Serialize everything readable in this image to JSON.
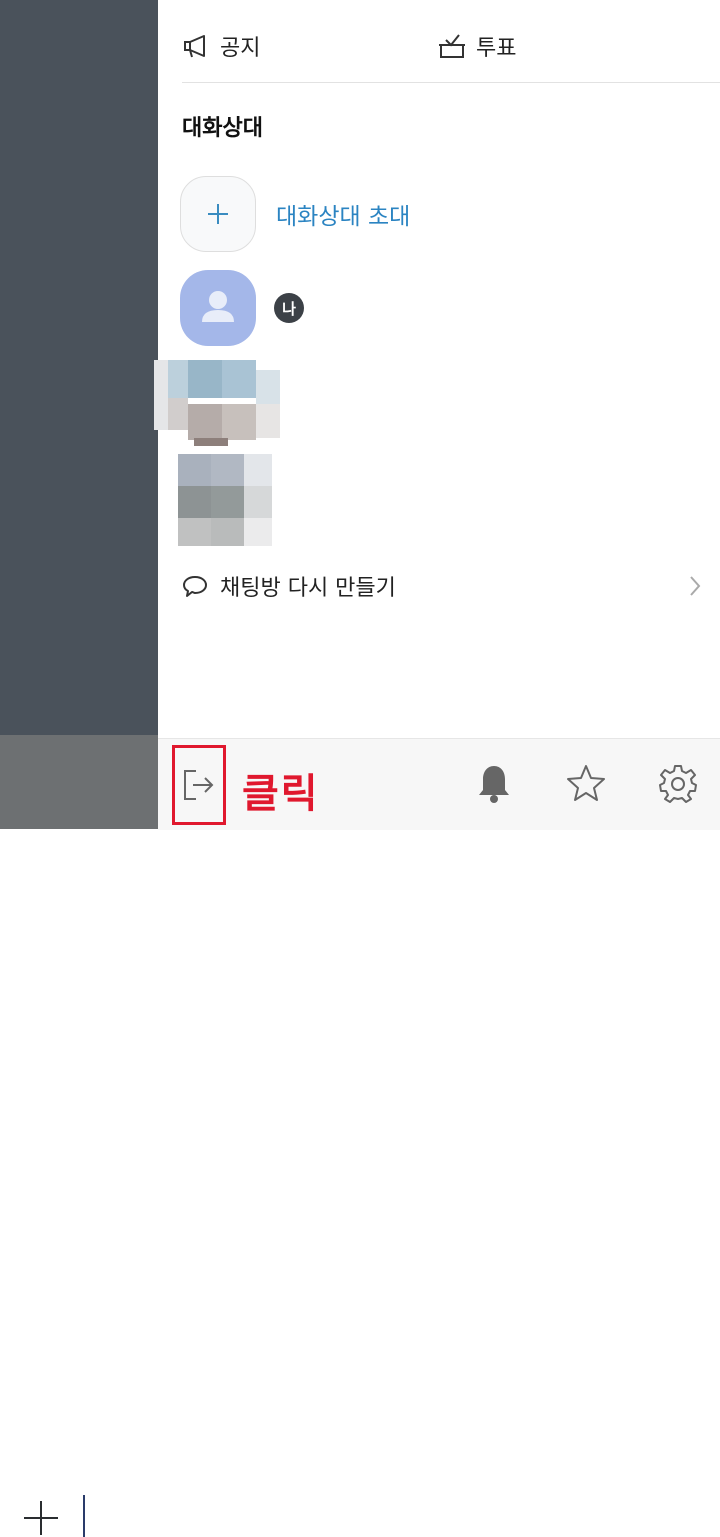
{
  "top_actions": {
    "notice_label": "공지",
    "vote_label": "투표"
  },
  "participants": {
    "title": "대화상대",
    "invite_label": "대화상대 초대",
    "me_badge": "나"
  },
  "recreate_label": "채팅방 다시 만들기",
  "annotation": {
    "click_label": "클릭",
    "highlight_color": "#e0182e"
  },
  "colors": {
    "accent": "#2b84c2",
    "avatar": "#a4b7e9",
    "dim_overlay": "#4a525b"
  },
  "icons": [
    "megaphone-icon",
    "vote-box-icon",
    "plus-icon",
    "person-icon",
    "chat-bubble-icon",
    "chevron-right-icon",
    "exit-icon",
    "bell-icon",
    "star-icon",
    "gear-icon"
  ]
}
